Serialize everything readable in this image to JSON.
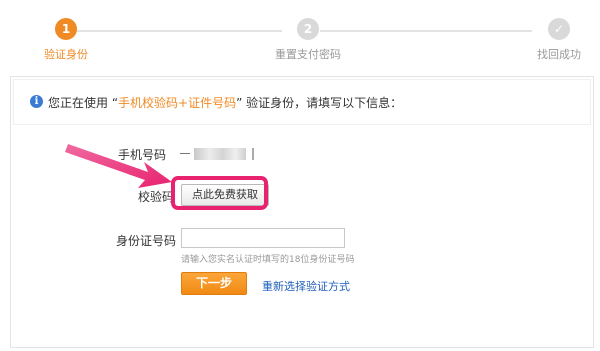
{
  "steps": [
    {
      "number": "1",
      "label": "验证身份",
      "state": "active"
    },
    {
      "number": "2",
      "label": "重置支付密码",
      "state": "inactive"
    },
    {
      "number": "✓",
      "label": "找回成功",
      "state": "inactive"
    }
  ],
  "notice": {
    "prefix": "您正在使用 “",
    "highlight": "手机校验码+证件号码",
    "suffix": "” 验证身份，请填写以下信息："
  },
  "form": {
    "phone_label": "手机号码",
    "code_label": "校验码",
    "get_code_button": "点此免费获取",
    "id_label": "身份证号码",
    "id_input_value": "",
    "id_hint": "请输入您实名认证时填写的18位身份证号码",
    "next_button": "下一步",
    "reselect_link": "重新选择验证方式"
  },
  "colors": {
    "accent": "#f08a24",
    "link": "#1f5fb8",
    "annotation": "#e8226f"
  }
}
